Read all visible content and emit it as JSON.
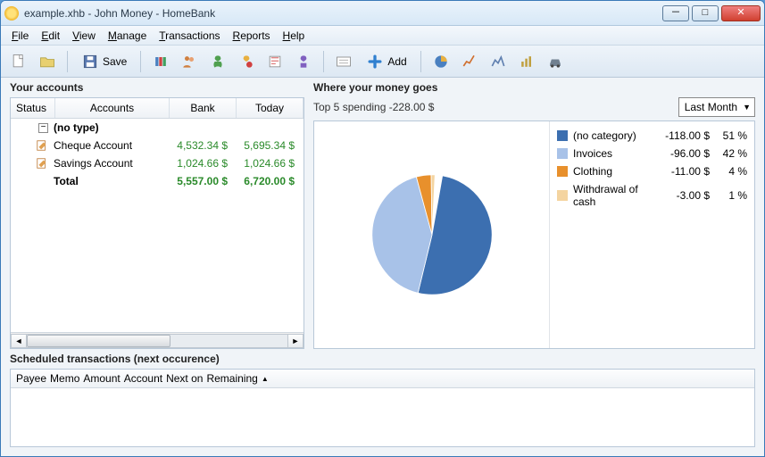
{
  "window": {
    "title": "example.xhb - John Money - HomeBank"
  },
  "menu": {
    "file": "File",
    "edit": "Edit",
    "view": "View",
    "manage": "Manage",
    "transactions": "Transactions",
    "reports": "Reports",
    "help": "Help"
  },
  "toolbar": {
    "save": "Save",
    "add": "Add"
  },
  "accounts": {
    "title": "Your accounts",
    "headers": {
      "status": "Status",
      "accounts": "Accounts",
      "bank": "Bank",
      "today": "Today"
    },
    "group": "(no type)",
    "rows": [
      {
        "name": "Cheque Account",
        "bank": "4,532.34 $",
        "today": "5,695.34 $"
      },
      {
        "name": "Savings Account",
        "bank": "1,024.66 $",
        "today": "1,024.66 $"
      }
    ],
    "total": {
      "label": "Total",
      "bank": "5,557.00 $",
      "today": "6,720.00 $"
    }
  },
  "spending": {
    "title": "Where your money goes",
    "subtitle": "Top 5 spending  -228.00 $",
    "period": "Last Month",
    "legend": [
      {
        "label": "(no category)",
        "amount": "-118.00 $",
        "pct": "51 %",
        "color": "#3c6fb0"
      },
      {
        "label": "Invoices",
        "amount": "-96.00 $",
        "pct": "42 %",
        "color": "#a8c2e8"
      },
      {
        "label": "Clothing",
        "amount": "-11.00 $",
        "pct": "4 %",
        "color": "#e8902c"
      },
      {
        "label": "Withdrawal of cash",
        "amount": "-3.00 $",
        "pct": "1 %",
        "color": "#f4d4a0"
      }
    ]
  },
  "scheduled": {
    "title": "Scheduled transactions (next occurence)",
    "headers": [
      "Payee",
      "Memo",
      "Amount",
      "Account",
      "Next on",
      "Remaining"
    ]
  },
  "chart_data": {
    "type": "pie",
    "title": "Top 5 spending",
    "total": -228.0,
    "currency": "$",
    "series": [
      {
        "name": "(no category)",
        "value": -118.0,
        "pct": 51,
        "color": "#3c6fb0"
      },
      {
        "name": "Invoices",
        "value": -96.0,
        "pct": 42,
        "color": "#a8c2e8"
      },
      {
        "name": "Clothing",
        "value": -11.0,
        "pct": 4,
        "color": "#e8902c"
      },
      {
        "name": "Withdrawal of cash",
        "value": -3.0,
        "pct": 1,
        "color": "#f4d4a0"
      }
    ]
  }
}
